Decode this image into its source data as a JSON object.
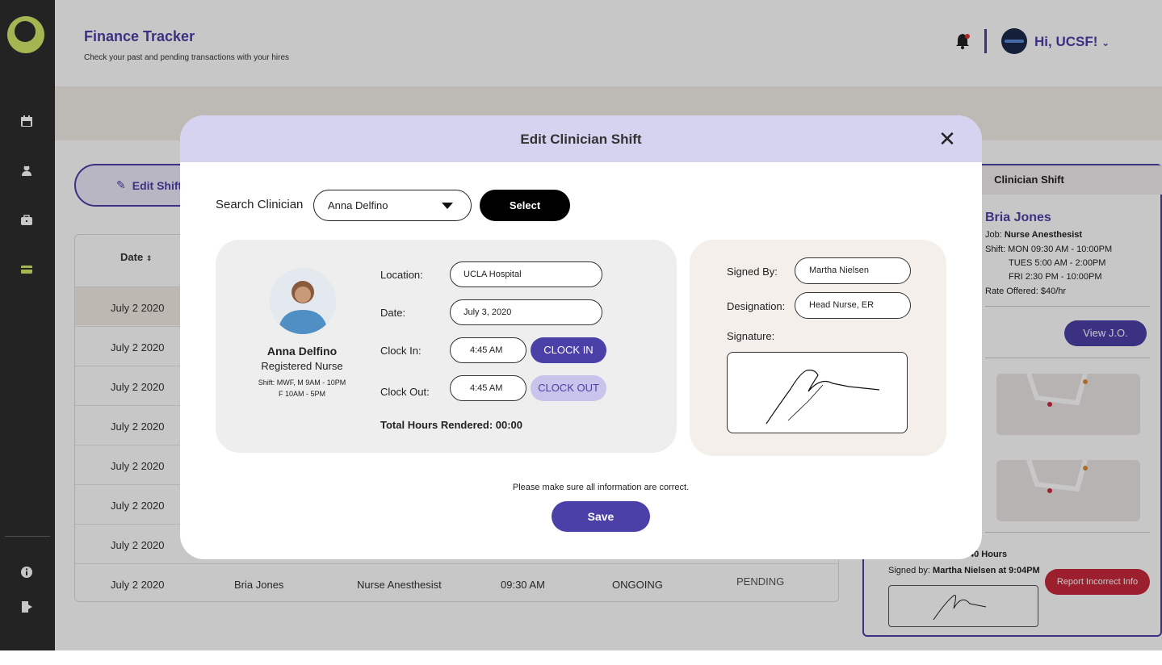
{
  "app": {
    "title": "Finance Tracker",
    "subtitle": "Check your past and pending transactions with your hires",
    "greeting": "Hi, UCSF!"
  },
  "sidebar": {
    "items": [
      {
        "icon": "calendar-icon"
      },
      {
        "icon": "user-nurse-icon"
      },
      {
        "icon": "briefcase-icon"
      },
      {
        "icon": "credit-card-icon",
        "active": true
      }
    ],
    "bottom": [
      {
        "icon": "info-icon"
      },
      {
        "icon": "logout-icon"
      }
    ]
  },
  "background": {
    "edit_shift_label": "Edit Shift",
    "table": {
      "date_header": "Date",
      "rows": [
        {
          "date": "July 2 2020"
        },
        {
          "date": "July 2 2020"
        },
        {
          "date": "July 2 2020"
        },
        {
          "date": "July 2 2020"
        },
        {
          "date": "July 2 2020"
        },
        {
          "date": "July 2 2020"
        },
        {
          "date": "July 2 2020"
        },
        {
          "date": "July 2 2020",
          "name": "Bria Jones",
          "job": "Nurse Anesthesist",
          "time": "09:30 AM",
          "status": "ONGOING",
          "payment": "PENDING"
        }
      ]
    },
    "panel": {
      "header": "Clinician Shift",
      "name": "Bria Jones",
      "job_label": "Job:",
      "job": "Nurse Anesthesist",
      "shift_label": "Shift:",
      "shift_lines": [
        "MON 09:30 AM - 10:00PM",
        "TUES 5:00 AM - 2:00PM",
        "FRI 2:30 PM - 10:00PM"
      ],
      "rate": "Rate Offered: $40/hr",
      "view_jo": "View J.O.",
      "hours": "40 Hours",
      "signed_prefix": "Signed by:",
      "signed_by": "Martha Nielsen at 9:04PM",
      "report_label": "Report Incorrect Info"
    }
  },
  "modal": {
    "title": "Edit Clinician Shift",
    "search_label": "Search Clinician",
    "search_value": "Anna Delfino",
    "select_label": "Select",
    "clinician": {
      "name": "Anna Delfino",
      "role": "Registered Nurse",
      "shift_line1": "Shift: MWF, M 9AM - 10PM",
      "shift_line2": "F 10AM - 5PM"
    },
    "fields": {
      "location_label": "Location:",
      "location_value": "UCLA Hospital",
      "date_label": "Date:",
      "date_value": "July 3, 2020",
      "clock_in_label": "Clock In:",
      "clock_in_value": "4:45 AM",
      "clock_in_btn": "CLOCK IN",
      "clock_out_label": "Clock Out:",
      "clock_out_value": "4:45 AM",
      "clock_out_btn": "CLOCK OUT",
      "total_hours": "Total Hours Rendered: 00:00"
    },
    "signature": {
      "signed_by_label": "Signed By:",
      "signed_by_value": "Martha Nielsen",
      "designation_label": "Designation:",
      "designation_value": "Head Nurse, ER",
      "signature_label": "Signature:"
    },
    "confirm_text": "Please make sure all information are correct.",
    "save_label": "Save"
  },
  "colors": {
    "accent": "#4b3fa8",
    "accent_light": "#d6d3f0",
    "sidebar": "#2d2d2d",
    "logo": "#d2e86a",
    "danger": "#c8283c"
  }
}
